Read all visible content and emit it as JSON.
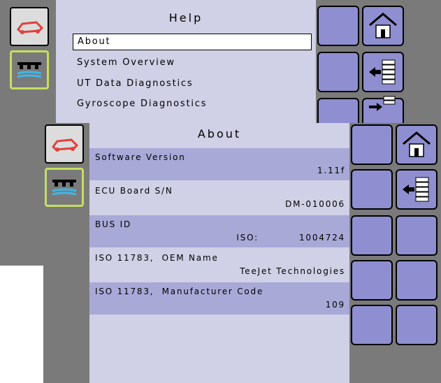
{
  "back_screen": {
    "title": "Help",
    "menu": [
      {
        "label": "About",
        "selected": true
      },
      {
        "label": "System Overview",
        "selected": false
      },
      {
        "label": "UT Data Diagnostics",
        "selected": false
      },
      {
        "label": "Gyroscope Diagnostics",
        "selected": false
      }
    ]
  },
  "front_screen": {
    "title": "About",
    "rows": [
      {
        "label": "Software Version",
        "value": "1.11f"
      },
      {
        "label": "ECU Board S/N",
        "value": "DM-010006"
      },
      {
        "label": "BUS ID",
        "prefix": "ISO:",
        "value": "1004724"
      },
      {
        "label": "ISO 11783,  OEM Name",
        "value": "TeeJet Technologies"
      },
      {
        "label": "ISO 11783,  Manufacturer Code",
        "value": "109"
      }
    ]
  },
  "icons": {
    "vehicle": "vehicle-icon",
    "boom": "boom-sprayer-icon",
    "home": "home-icon",
    "back": "back-arrow-list-icon",
    "forward": "forward-arrow-list-icon"
  },
  "colors": {
    "panel_bg": "#7a7a7a",
    "content_bg": "#d0d0e6",
    "row_highlight": "#a9a9d8",
    "button_fill": "#8e8ed0",
    "boom_border": "#c6de5e",
    "vehicle_red": "#e0403c"
  }
}
